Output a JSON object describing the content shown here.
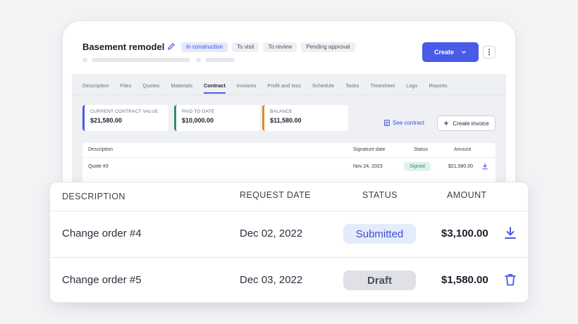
{
  "project": {
    "title": "Basement remodel",
    "statuses": [
      "In construction",
      "To visit",
      "To review",
      "Pending approval"
    ],
    "create_label": "Create"
  },
  "tabs": [
    "Description",
    "Files",
    "Quotes",
    "Materials",
    "Contract",
    "Invoices",
    "Profit and loss",
    "Schedule",
    "Tasks",
    "Timesheet",
    "Logs",
    "Reports"
  ],
  "active_tab": "Contract",
  "summary_cards": [
    {
      "label": "CURRENT CONTRACT VALUE",
      "value": "$21,580.00",
      "color": "#4a5be8"
    },
    {
      "label": "PAID TO DATE",
      "value": "$10,000.00",
      "color": "#2f8f63"
    },
    {
      "label": "BALANCE",
      "value": "$11,580.00",
      "color": "#e08a2c"
    }
  ],
  "actions": {
    "see_contract": "See contract",
    "create_invoice": "Create invoice"
  },
  "contract_table": {
    "headers": {
      "description": "Description",
      "signature_date": "Signature date",
      "status": "Status",
      "amount": "Amount"
    },
    "rows": [
      {
        "description": "Quote #3",
        "date": "Nov 24, 2023",
        "status": "Signed",
        "amount": "$21,580.00",
        "action_icon": "download-icon"
      }
    ]
  },
  "change_orders": {
    "headers": {
      "description": "DESCRIPTION",
      "request_date": "REQUEST DATE",
      "status": "STATUS",
      "amount": "AMOUNT"
    },
    "rows": [
      {
        "description": "Change order #4",
        "date": "Dec 02, 2022",
        "status": "Submitted",
        "amount": "$3,100.00",
        "action_icon": "download-icon"
      },
      {
        "description": "Change order #5",
        "date": "Dec 03, 2022",
        "status": "Draft",
        "amount": "$1,580.00",
        "action_icon": "trash-icon"
      }
    ]
  },
  "colors": {
    "accent": "#4a5be8",
    "submitted_bg": "#e4ebfb",
    "draft_bg": "#dfe1e6",
    "signed_bg": "#dff3ea"
  }
}
